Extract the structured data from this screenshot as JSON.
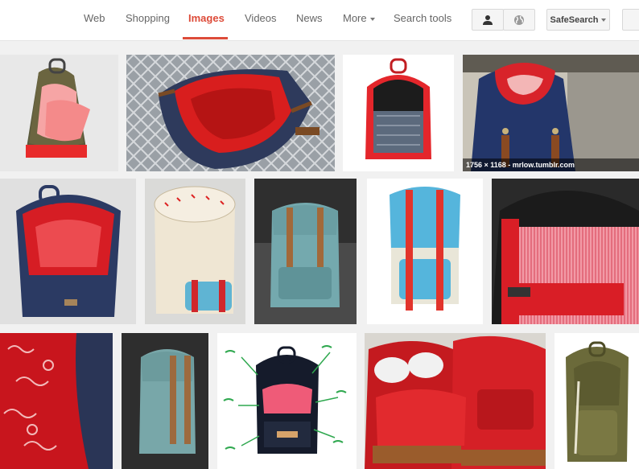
{
  "nav": {
    "tabs": [
      {
        "label": "Web"
      },
      {
        "label": "Shopping"
      },
      {
        "label": "Images"
      },
      {
        "label": "Videos"
      },
      {
        "label": "News"
      },
      {
        "label": "More"
      },
      {
        "label": "Search tools"
      }
    ],
    "active_tab": "Images",
    "accent_color": "#dd4b39"
  },
  "controls": {
    "account_icon": "person-icon",
    "globe_icon": "globe-icon",
    "safesearch_label": "SafeSearch"
  },
  "results": {
    "hover_caption": "1756 × 1168 - mrlow.tumblr.com",
    "images": [
      {
        "subject": "camo backpack open"
      },
      {
        "subject": "navy backpack red lining on rug"
      },
      {
        "subject": "red backpack open"
      },
      {
        "subject": "navy backpack red bandana top"
      },
      {
        "subject": "navy backpack red paisley"
      },
      {
        "subject": "cream rolltop backpack"
      },
      {
        "subject": "teal backpack"
      },
      {
        "subject": "light blue backpack red straps"
      },
      {
        "subject": "black backpack striped lining"
      },
      {
        "subject": "red paisley closeup"
      },
      {
        "subject": "teal backpack side view"
      },
      {
        "subject": "annotated backpack"
      },
      {
        "subject": "red backpack with sneakers"
      },
      {
        "subject": "olive green backpack"
      }
    ]
  }
}
